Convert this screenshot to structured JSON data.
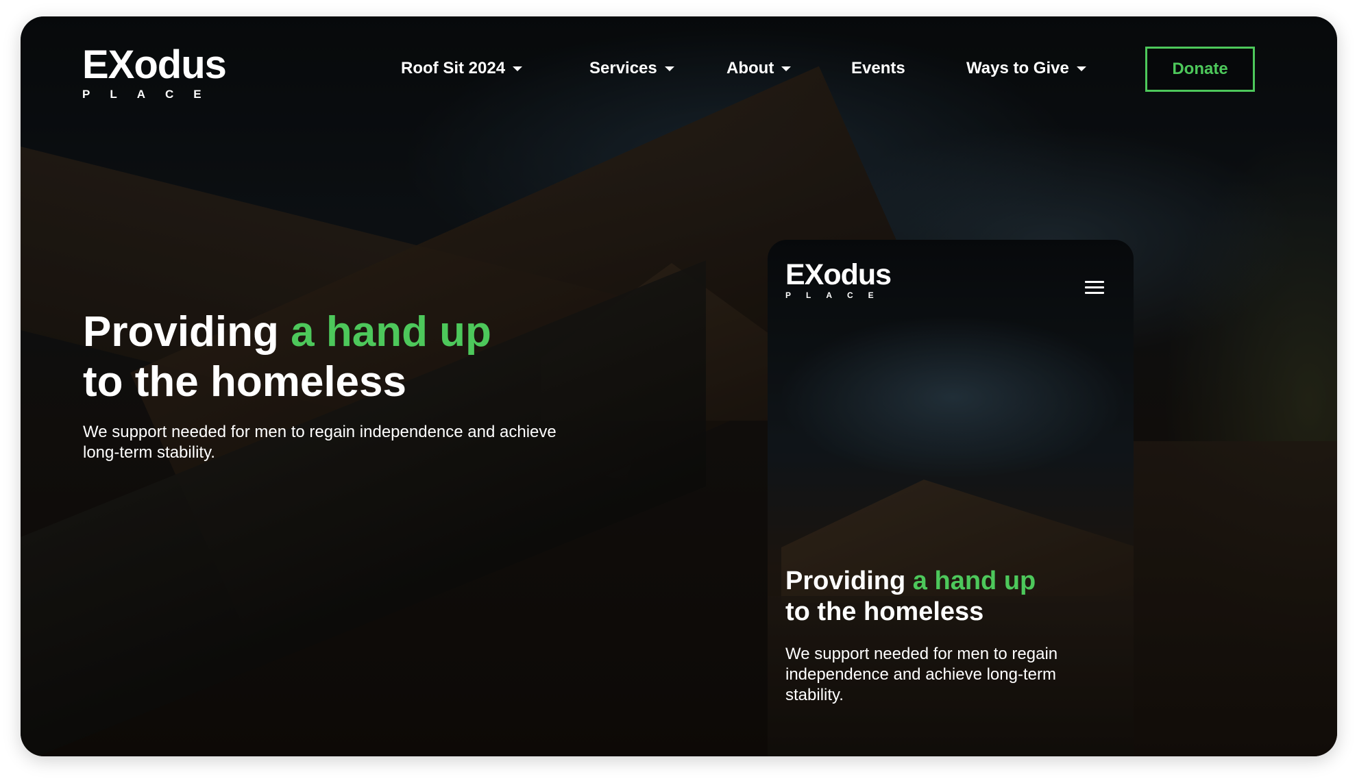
{
  "brand": {
    "logo_main": "EXodus",
    "logo_sub": "PLACE"
  },
  "nav": {
    "items": [
      {
        "label": "Roof Sit 2024",
        "has_dropdown": true
      },
      {
        "label": "Services",
        "has_dropdown": true
      },
      {
        "label": "About",
        "has_dropdown": true
      },
      {
        "label": "Events",
        "has_dropdown": false
      },
      {
        "label": "Ways to Give",
        "has_dropdown": true
      }
    ],
    "donate_label": "Donate"
  },
  "hero": {
    "title_part1": "Providing ",
    "title_highlight": "a hand up",
    "title_part2": "to the homeless",
    "subtitle": "We support needed for men to regain independence and achieve long-term stability."
  },
  "mobile": {
    "logo_main": "EXodus",
    "logo_sub": "PLACE",
    "menu_icon": "hamburger-menu-icon",
    "title_part1": "Providing ",
    "title_highlight": "a hand up",
    "title_part2": "to the homeless",
    "subtitle": "We support needed for men to regain independence and achieve long-term stability."
  },
  "colors": {
    "accent": "#4dc85b",
    "text": "#ffffff"
  }
}
